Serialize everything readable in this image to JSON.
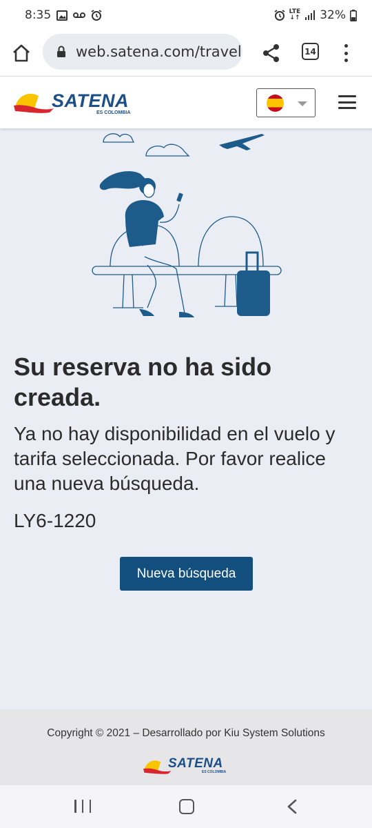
{
  "status_bar": {
    "time": "8:35",
    "lte": "LTE",
    "battery": "32%"
  },
  "browser": {
    "url": "web.satena.com/travel",
    "tab_count": "14"
  },
  "header": {
    "logo_name": "SATENA",
    "logo_tagline": "ES COLOMBIA",
    "language_flag": "spain-flag"
  },
  "message": {
    "title": "Su reserva no ha sido creada.",
    "description": "Ya no hay disponibilidad en el vuelo y tarifa seleccionada. Por favor realice una nueva búsqueda.",
    "code": "LY6-1220",
    "button_label": "Nueva búsqueda"
  },
  "footer": {
    "copyright": "Copyright © 2021 – Desarrollado por Kiu System Solutions",
    "logo_name": "SATENA",
    "logo_tagline": "ES COLOMBIA"
  },
  "colors": {
    "brand_blue": "#124f7f",
    "logo_blue": "#1c4f88",
    "logo_yellow": "#f9c400",
    "logo_red": "#d8262e",
    "page_background": "#ebedf5"
  }
}
